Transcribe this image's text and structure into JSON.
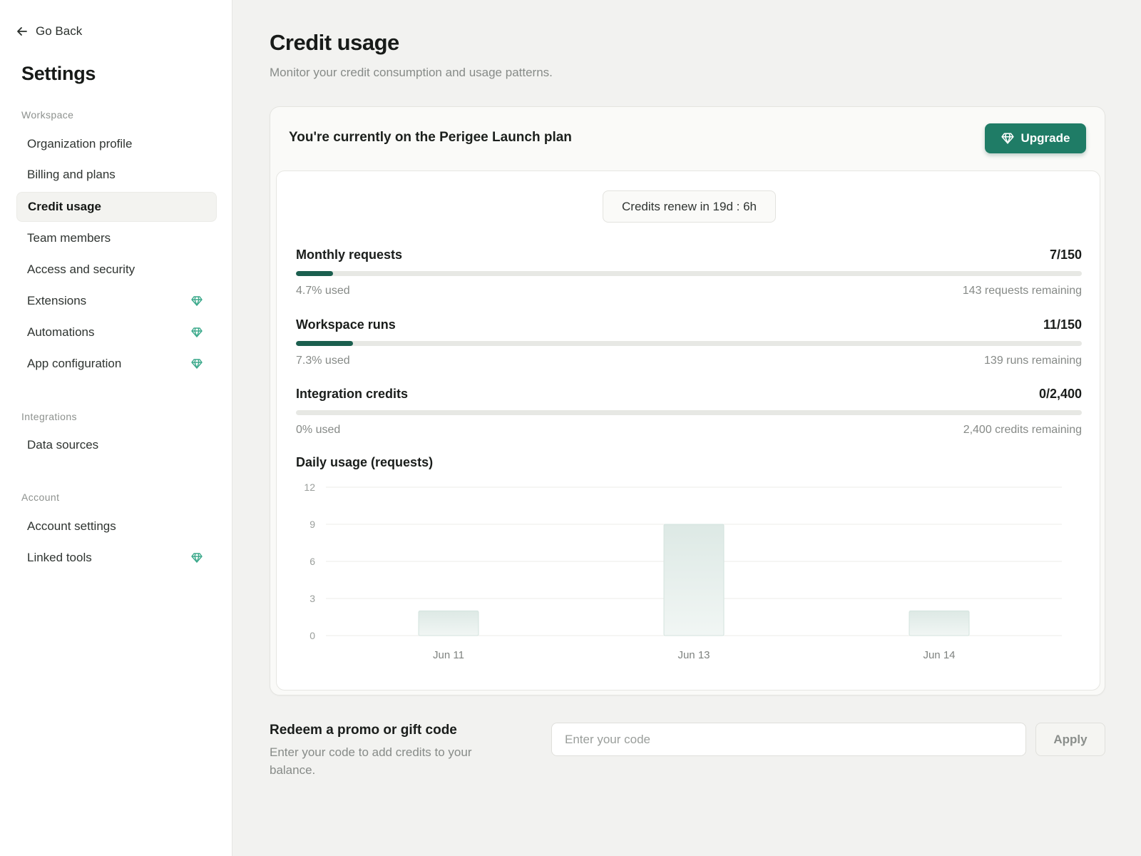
{
  "sidebar": {
    "go_back": "Go Back",
    "title": "Settings",
    "sections": [
      {
        "label": "Workspace",
        "items": [
          {
            "label": "Organization profile",
            "premium": false,
            "active": false
          },
          {
            "label": "Billing and plans",
            "premium": false,
            "active": false
          },
          {
            "label": "Credit usage",
            "premium": false,
            "active": true
          },
          {
            "label": "Team members",
            "premium": false,
            "active": false
          },
          {
            "label": "Access and security",
            "premium": false,
            "active": false
          },
          {
            "label": "Extensions",
            "premium": true,
            "active": false
          },
          {
            "label": "Automations",
            "premium": true,
            "active": false
          },
          {
            "label": "App configuration",
            "premium": true,
            "active": false
          }
        ]
      },
      {
        "label": "Integrations",
        "items": [
          {
            "label": "Data sources",
            "premium": false,
            "active": false
          }
        ]
      },
      {
        "label": "Account",
        "items": [
          {
            "label": "Account settings",
            "premium": false,
            "active": false
          },
          {
            "label": "Linked tools",
            "premium": true,
            "active": false
          }
        ]
      }
    ]
  },
  "main": {
    "title": "Credit usage",
    "subtitle": "Monitor your credit consumption and usage patterns.",
    "plan_text": "You're currently on the Perigee Launch plan",
    "upgrade_label": "Upgrade",
    "renew_text": "Credits renew in 19d : 6h",
    "metrics": [
      {
        "name": "Monthly requests",
        "value": "7/150",
        "used": "4.7% used",
        "remaining": "143 requests remaining",
        "fraction": 0.047
      },
      {
        "name": "Workspace runs",
        "value": "11/150",
        "used": "7.3% used",
        "remaining": "139 runs remaining",
        "fraction": 0.073
      },
      {
        "name": "Integration credits",
        "value": "0/2,400",
        "used": "0% used",
        "remaining": "2,400 credits remaining",
        "fraction": 0
      }
    ],
    "chart_title": "Daily usage (requests)"
  },
  "chart_data": {
    "type": "bar",
    "title": "Daily usage (requests)",
    "categories": [
      "Jun 11",
      "Jun 13",
      "Jun 14"
    ],
    "values": [
      2,
      9,
      2
    ],
    "yticks": [
      "12",
      "9",
      "6",
      "3",
      "0"
    ],
    "ylim": [
      0,
      12
    ],
    "grid": true,
    "bar_color": "#e6f0ed"
  },
  "promo": {
    "title": "Redeem a promo or gift code",
    "description": "Enter your code to add credits to your balance.",
    "placeholder": "Enter your code",
    "apply_label": "Apply"
  },
  "colors": {
    "accent": "#1f7c66",
    "progress_fill": "#1b5f4f",
    "gem": "#3aa88a"
  },
  "icons": {
    "back": "arrow-left-icon",
    "premium": "gem-icon",
    "upgrade": "gem-icon"
  }
}
